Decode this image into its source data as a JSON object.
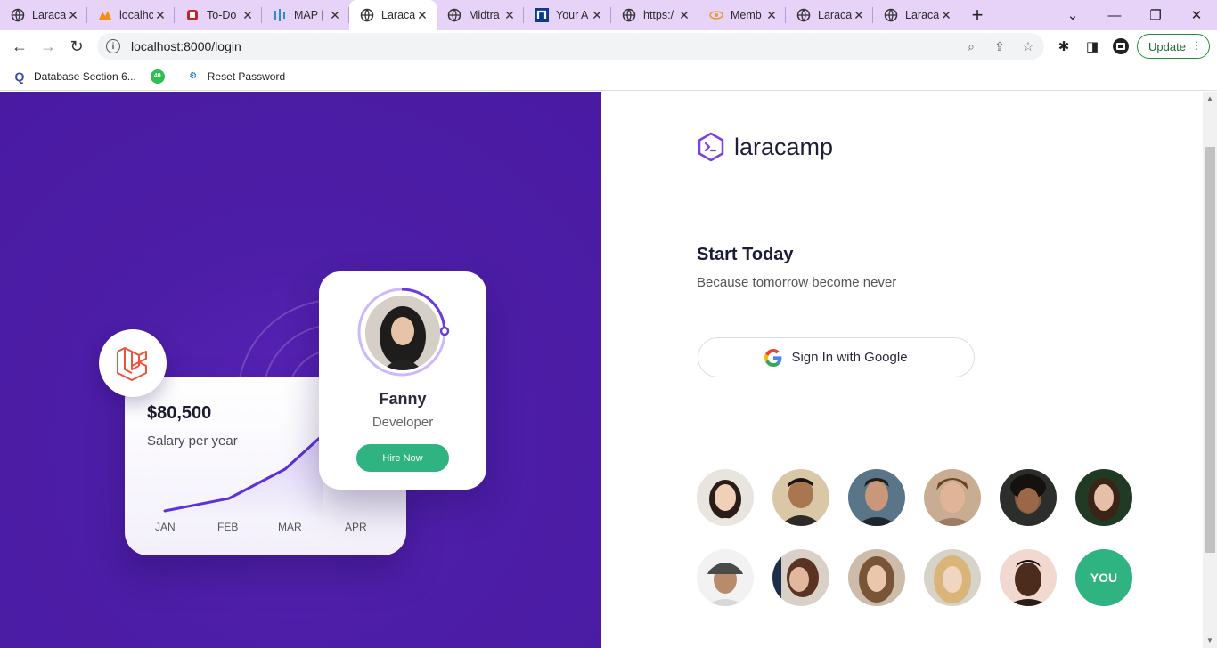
{
  "browser": {
    "tabs": [
      {
        "title": "Laraca",
        "icon": "globe-icon",
        "active": false
      },
      {
        "title": "localhc",
        "icon": "phpmyadmin-icon",
        "active": false
      },
      {
        "title": "To-Do",
        "icon": "todo-icon",
        "active": false
      },
      {
        "title": "MAP |",
        "icon": "map-icon",
        "active": false
      },
      {
        "title": "Laraca",
        "icon": "globe-icon",
        "active": true
      },
      {
        "title": "Midtra",
        "icon": "globe-icon",
        "active": false
      },
      {
        "title": "Your A",
        "icon": "n-icon",
        "active": false
      },
      {
        "title": "https:/",
        "icon": "globe-icon",
        "active": false
      },
      {
        "title": "Memb",
        "icon": "member-icon",
        "active": false
      },
      {
        "title": "Laraca",
        "icon": "globe-icon",
        "active": false
      },
      {
        "title": "Laraca",
        "icon": "globe-icon",
        "active": false
      }
    ],
    "url": "localhost:8000/login",
    "update_label": "Update",
    "bookmarks": [
      {
        "label": "Database Section 6...",
        "icon": "q-icon"
      },
      {
        "label": "",
        "icon": "badge-40-icon",
        "badge": "40"
      },
      {
        "label": "Reset Password",
        "icon": "reset-icon"
      }
    ]
  },
  "hero": {
    "salary_value": "$80,500",
    "salary_label": "Salary per year",
    "months": [
      "JAN",
      "FEB",
      "MAR",
      "APR"
    ],
    "profile_name": "Fanny",
    "profile_role": "Developer",
    "hire_label": "Hire Now"
  },
  "auth": {
    "brand": "laracamp",
    "headline": "Start Today",
    "subline": "Because tomorrow become never",
    "google_label": "Sign In with Google",
    "you_label": "YOU"
  },
  "colors": {
    "hero_bg": "#4a1aa3",
    "accent_green": "#2fb380",
    "brand_purple": "#7b3fe4",
    "tabstrip": "#e7d3f7"
  }
}
